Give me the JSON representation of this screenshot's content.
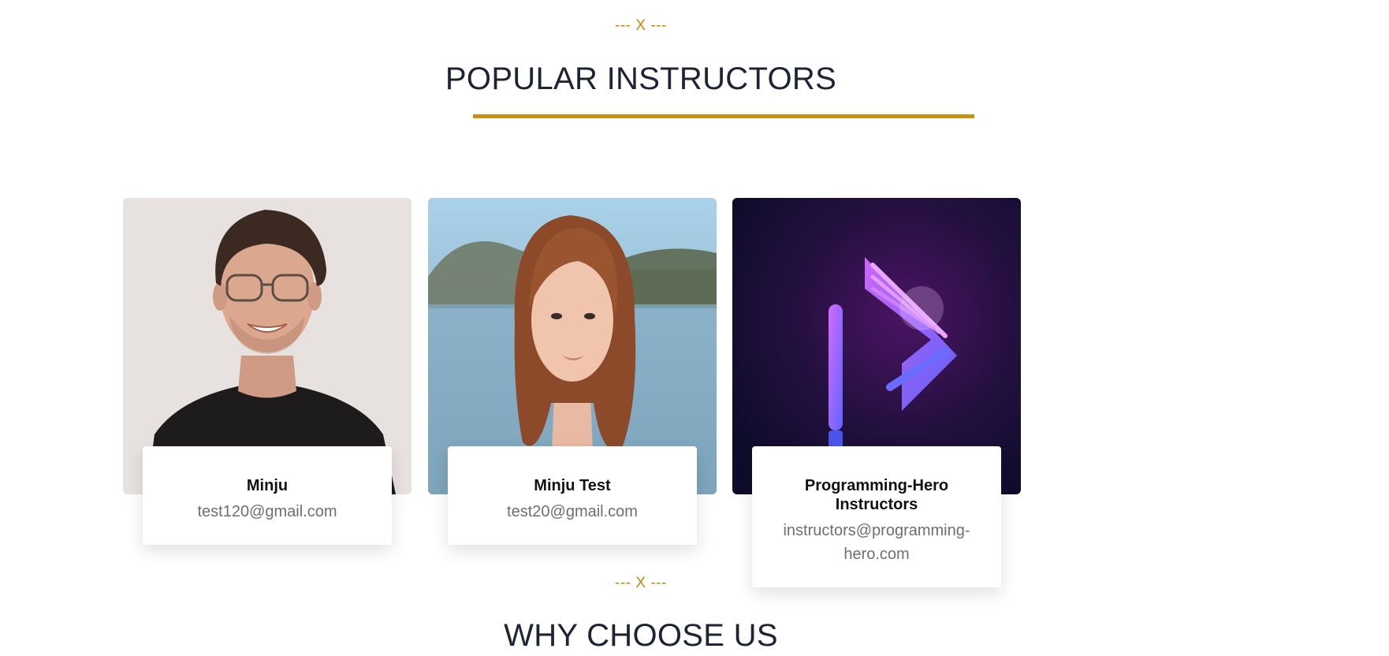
{
  "popular_section": {
    "divider": "--- X ---",
    "title": "POPULAR INSTRUCTORS"
  },
  "instructors": [
    {
      "name": "Minju",
      "email": "test120@gmail.com"
    },
    {
      "name": "Minju Test",
      "email": "test20@gmail.com"
    },
    {
      "name": "Programming-Hero Instructors",
      "email": "instructors@programming-hero.com"
    }
  ],
  "why_section": {
    "divider": "--- X ---",
    "title": "WHY CHOOSE US"
  },
  "colors": {
    "accent": "#c69216",
    "divider_text": "#c8860a",
    "heading": "#1e2433"
  }
}
